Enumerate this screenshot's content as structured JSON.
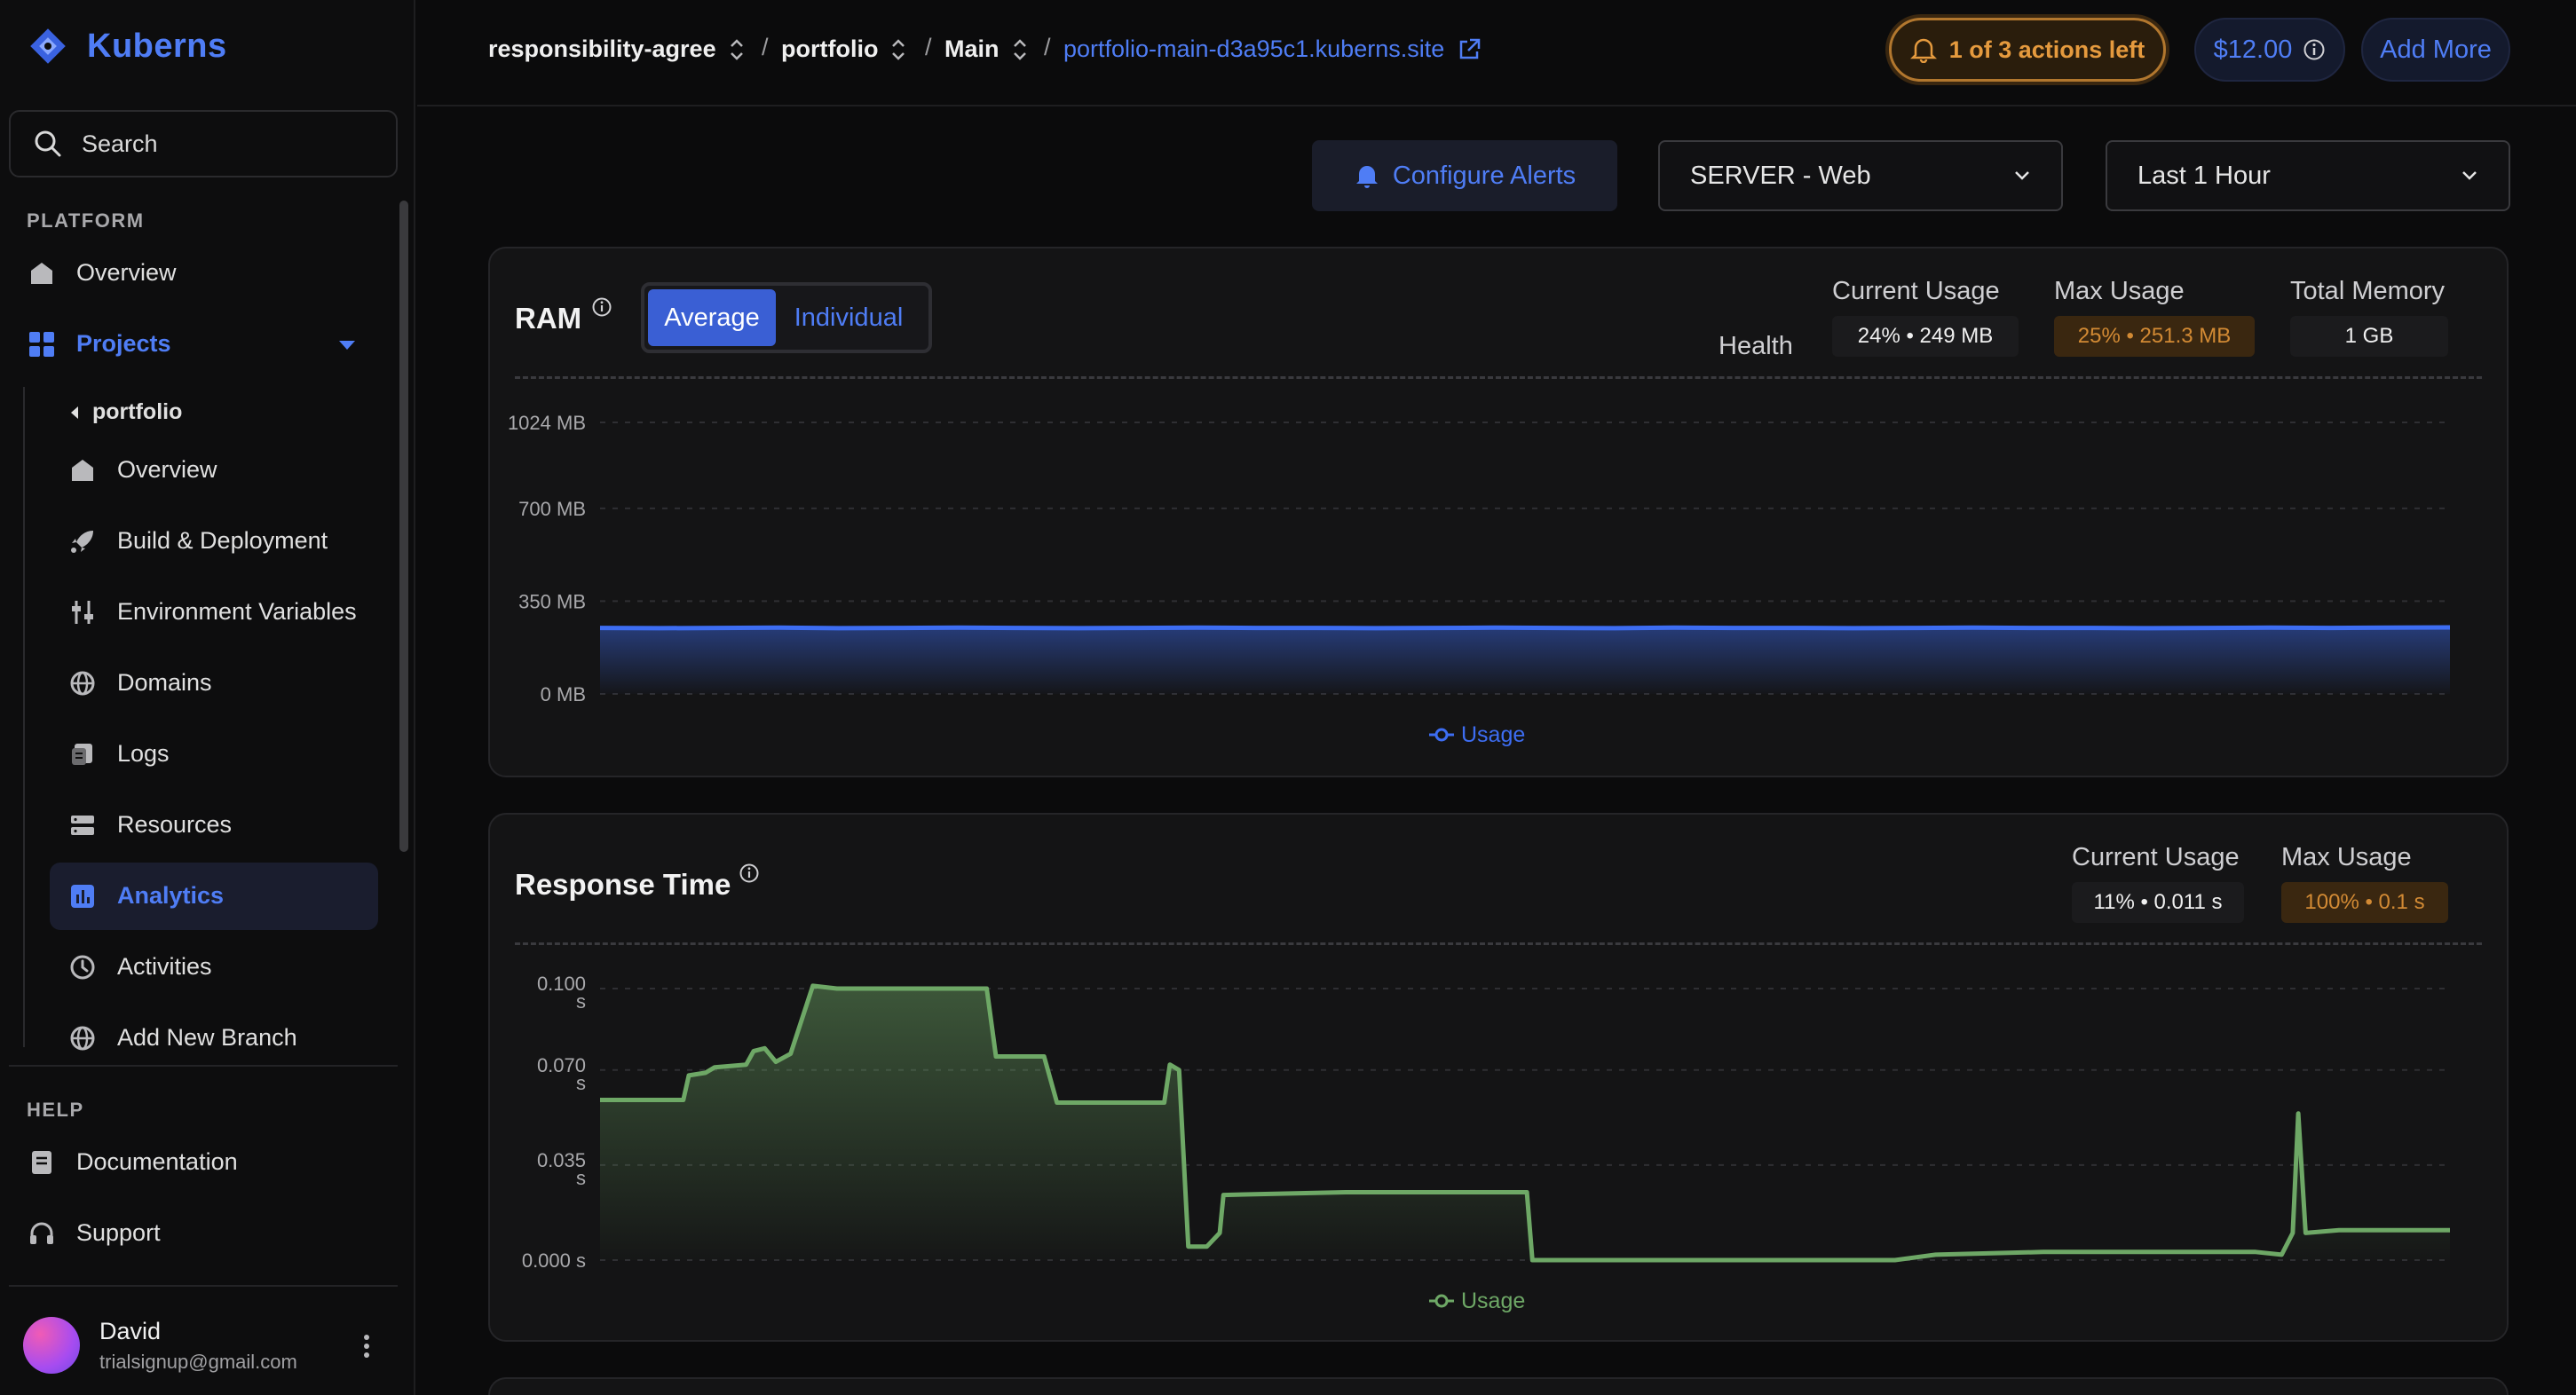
{
  "app": {
    "name": "Kuberns"
  },
  "sidebar": {
    "search_label": "Search",
    "platform_label": "PLATFORM",
    "platform_items": [
      {
        "label": "Overview"
      },
      {
        "label": "Projects"
      }
    ],
    "project_back": "portfolio",
    "project_items": [
      {
        "label": "Overview"
      },
      {
        "label": "Build & Deployment"
      },
      {
        "label": "Environment Variables"
      },
      {
        "label": "Domains"
      },
      {
        "label": "Logs"
      },
      {
        "label": "Resources"
      },
      {
        "label": "Analytics"
      },
      {
        "label": "Activities"
      },
      {
        "label": "Add New Branch"
      }
    ],
    "help_label": "HELP",
    "help_items": [
      {
        "label": "Documentation"
      },
      {
        "label": "Support"
      }
    ],
    "user": {
      "name": "David",
      "email": "trialsignup@gmail.com"
    }
  },
  "topbar": {
    "breadcrumb": [
      "responsibility-agree",
      "portfolio",
      "Main"
    ],
    "separator": "/",
    "site_link": "portfolio-main-d3a95c1.kuberns.site",
    "actions_left": "1 of 3 actions left",
    "balance": "$12.00",
    "add_more": "Add More"
  },
  "toolbar": {
    "configure_alerts": "Configure Alerts",
    "server_select": "SERVER - Web",
    "range_select": "Last 1 Hour"
  },
  "ram": {
    "title": "RAM",
    "toggle": {
      "average": "Average",
      "individual": "Individual"
    },
    "health_label": "Health",
    "current_label": "Current Usage",
    "current_value": "24% • 249 MB",
    "max_label": "Max Usage",
    "max_value": "25% • 251.3 MB",
    "total_label": "Total Memory",
    "total_value": "1 GB"
  },
  "response": {
    "title": "Response Time",
    "current_label": "Current Usage",
    "current_value": "11% • 0.011 s",
    "max_label": "Max Usage",
    "max_value": "100% • 0.1 s"
  },
  "colors": {
    "accent": "#4f7df5",
    "ram_line": "#3d6df2",
    "response_line": "#6ea866",
    "warning": "#d28a34"
  },
  "chart_data": [
    {
      "type": "area",
      "yticks": [
        "1024 MB",
        "700 MB",
        "350 MB",
        "0 MB"
      ],
      "ytick_values": [
        1024,
        700,
        350,
        0
      ],
      "ylim": [
        0,
        1024
      ],
      "grid": true,
      "legend": "bottom-center",
      "series": [
        {
          "name": "Usage",
          "values": [
            249,
            248,
            249,
            250,
            248,
            249,
            250,
            249,
            248,
            249,
            250,
            249,
            249,
            248,
            249,
            250,
            249,
            248,
            250,
            249,
            249,
            248,
            249,
            250,
            249,
            249,
            248,
            249,
            250,
            249,
            250,
            251
          ]
        }
      ]
    },
    {
      "type": "area",
      "yticks": [
        "0.100 s",
        "0.070 s",
        "0.035 s",
        "0.000 s"
      ],
      "ytick_values": [
        0.1,
        0.07,
        0.035,
        0
      ],
      "ylim": [
        0,
        0.1
      ],
      "grid": true,
      "legend": "bottom-center",
      "series": [
        {
          "name": "Usage",
          "points": [
            [
              0,
              0.059
            ],
            [
              0.045,
              0.059
            ],
            [
              0.048,
              0.068
            ],
            [
              0.057,
              0.069
            ],
            [
              0.062,
              0.071
            ],
            [
              0.079,
              0.072
            ],
            [
              0.083,
              0.077
            ],
            [
              0.089,
              0.078
            ],
            [
              0.095,
              0.073
            ],
            [
              0.103,
              0.076
            ],
            [
              0.115,
              0.101
            ],
            [
              0.128,
              0.1
            ],
            [
              0.148,
              0.1
            ],
            [
              0.158,
              0.1
            ],
            [
              0.165,
              0.1
            ],
            [
              0.178,
              0.1
            ],
            [
              0.2,
              0.1
            ],
            [
              0.209,
              0.1
            ],
            [
              0.214,
              0.075
            ],
            [
              0.24,
              0.075
            ],
            [
              0.247,
              0.058
            ],
            [
              0.305,
              0.058
            ],
            [
              0.308,
              0.072
            ],
            [
              0.313,
              0.07
            ],
            [
              0.318,
              0.005
            ],
            [
              0.328,
              0.005
            ],
            [
              0.335,
              0.01
            ],
            [
              0.337,
              0.024
            ],
            [
              0.403,
              0.025
            ],
            [
              0.468,
              0.025
            ],
            [
              0.501,
              0.025
            ],
            [
              0.504,
              0.0
            ],
            [
              0.7,
              0.0
            ],
            [
              0.722,
              0.002
            ],
            [
              0.78,
              0.003
            ],
            [
              0.895,
              0.003
            ],
            [
              0.909,
              0.002
            ],
            [
              0.915,
              0.01
            ],
            [
              0.918,
              0.054
            ],
            [
              0.922,
              0.01
            ],
            [
              0.94,
              0.011
            ],
            [
              1.0,
              0.011
            ]
          ]
        }
      ]
    }
  ]
}
